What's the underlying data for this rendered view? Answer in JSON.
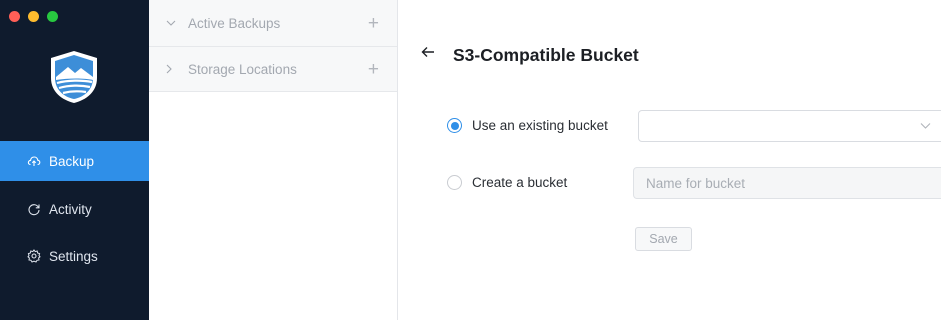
{
  "window": {
    "traffic_lights": {
      "close_color": "#ff5f57",
      "minimize_color": "#febc2e",
      "zoom_color": "#28c840"
    }
  },
  "sidebar": {
    "background": "#0f1b2d",
    "logo_icon": "shield-mountain-icon",
    "items": [
      {
        "label": "Backup",
        "icon": "cloud-upload-icon",
        "active": true
      },
      {
        "label": "Activity",
        "icon": "refresh-icon",
        "active": false
      },
      {
        "label": "Settings",
        "icon": "gear-icon",
        "active": false
      }
    ],
    "active_color": "#2f8fe8"
  },
  "middle": {
    "groups": [
      {
        "label": "Active Backups",
        "expanded": true,
        "add_label": "+"
      },
      {
        "label": "Storage Locations",
        "expanded": false,
        "add_label": "+"
      }
    ]
  },
  "main": {
    "title": "S3-Compatible Bucket",
    "options": [
      {
        "label": "Use an existing bucket",
        "selected": true
      },
      {
        "label": "Create a bucket",
        "selected": false
      }
    ],
    "existing_bucket_value": "",
    "bucket_name_placeholder": "Name for bucket",
    "bucket_name_value": "",
    "save_label": "Save"
  }
}
